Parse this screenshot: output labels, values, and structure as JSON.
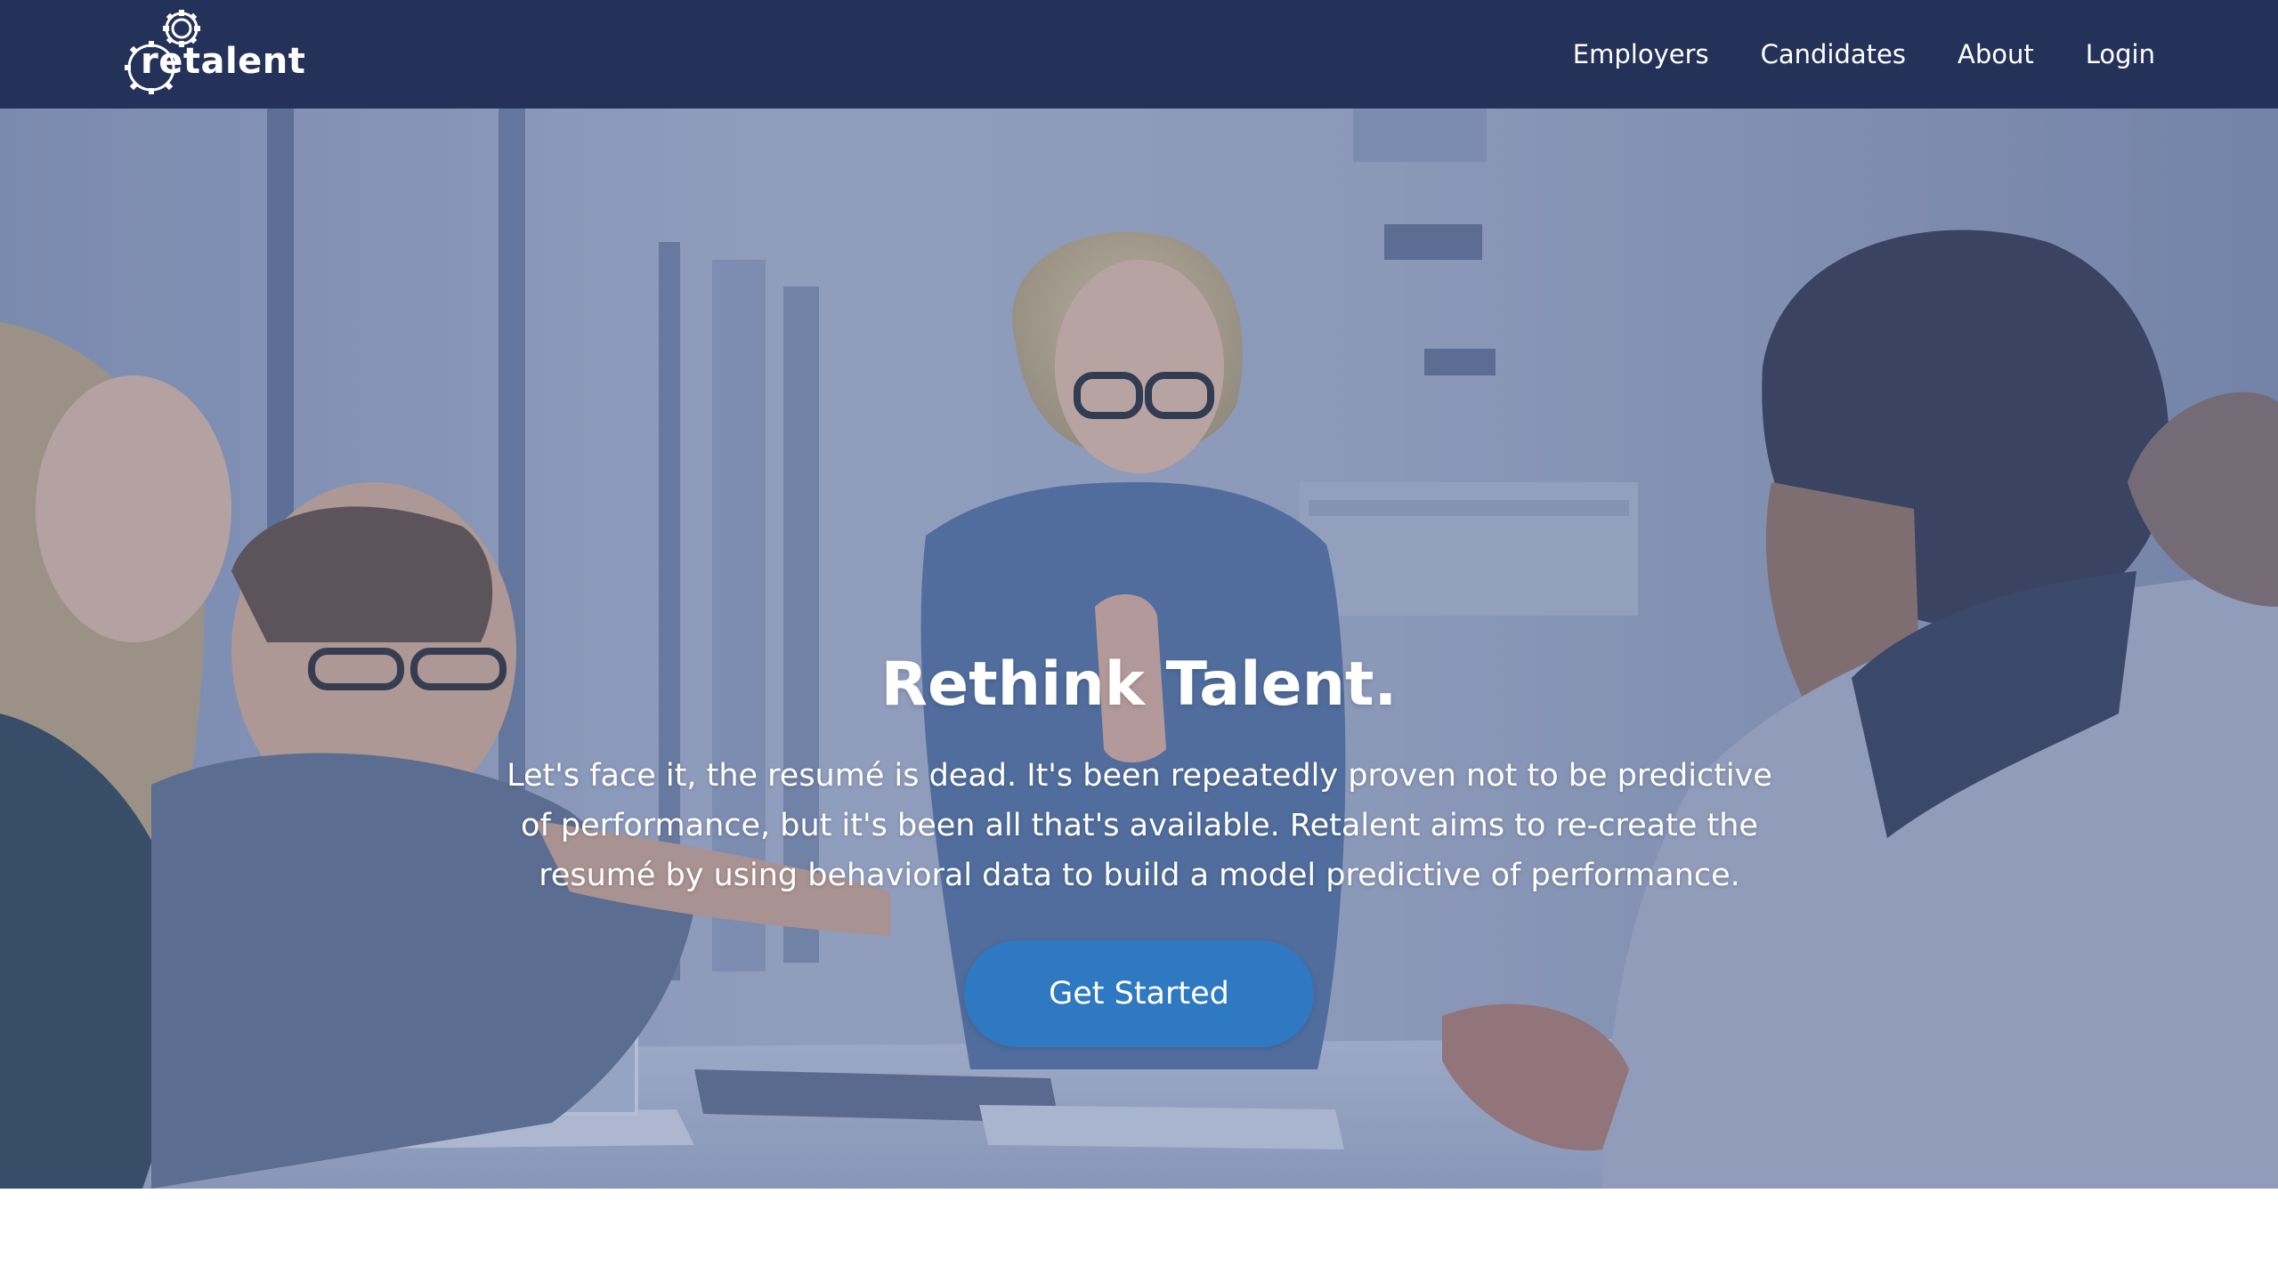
{
  "brand": {
    "logo_text": "retalent",
    "logo_icon": "gear-icon",
    "colors": {
      "nav_background": "#243259",
      "button_background": "#2f79c3",
      "text_on_dark": "#ffffff"
    }
  },
  "nav": {
    "links": [
      {
        "label": "Employers"
      },
      {
        "label": "Candidates"
      },
      {
        "label": "About"
      },
      {
        "label": "Login"
      }
    ]
  },
  "hero": {
    "title": "Rethink Talent.",
    "text": "Let's face it, the resumé is dead. It's been repeatedly proven not to be predictive of performance, but it's been all that's available. Retalent aims to re-create the resumé by using behavioral data to build a model predictive of performance.",
    "cta_label": "Get Started",
    "background": "office meeting photograph with blue overlay"
  }
}
